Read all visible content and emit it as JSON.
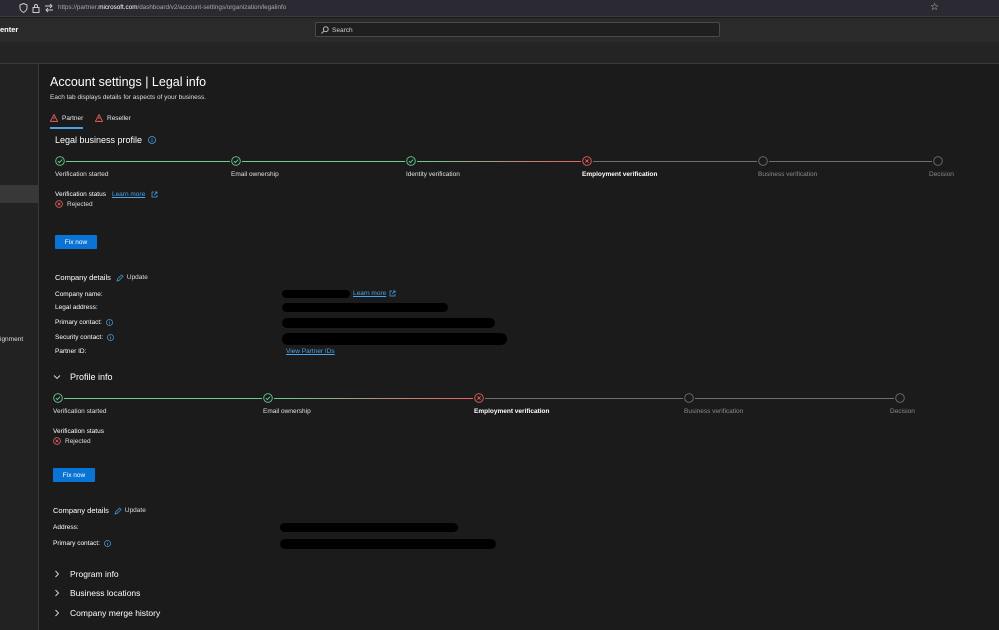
{
  "browser": {
    "url_prefix": "https://partner.",
    "url_domain": "microsoft.com",
    "url_path": "/dashboard/v2/account-settings/organization/legalinfo"
  },
  "app": {
    "brand": "enter",
    "search_placeholder": "Search"
  },
  "leftnav": {
    "partial_item": "ignment"
  },
  "page": {
    "title": "Account settings | Legal info",
    "subtitle": "Each tab displays details for aspects of your business.",
    "tabs": [
      {
        "label": "Partner",
        "selected": true
      },
      {
        "label": "Reseller",
        "selected": false
      }
    ]
  },
  "legal_profile": {
    "title": "Legal business profile",
    "steps": [
      {
        "label": "Verification started",
        "state": "done"
      },
      {
        "label": "Email ownership",
        "state": "done"
      },
      {
        "label": "Identity verification",
        "state": "done"
      },
      {
        "label": "Employment verification",
        "state": "rejected"
      },
      {
        "label": "Business verification",
        "state": "pending"
      },
      {
        "label": "Decision",
        "state": "pending"
      }
    ],
    "status_label": "Verification status",
    "learn_more": "Learn more",
    "status_value": "Rejected",
    "fix_button": "Fix now",
    "company_details": {
      "title": "Company details",
      "update": "Update",
      "rows": {
        "company_name": "Company name:",
        "legal_address": "Legal address:",
        "primary_contact": "Primary contact:",
        "security_contact": "Security contact:",
        "partner_id": "Partner ID:"
      },
      "learn_more": "Learn more",
      "view_partner_ids": "View Partner IDs"
    }
  },
  "profile_info": {
    "title": "Profile info",
    "steps": [
      {
        "label": "Verification started",
        "state": "done"
      },
      {
        "label": "Email ownership",
        "state": "done"
      },
      {
        "label": "Employment verification",
        "state": "rejected"
      },
      {
        "label": "Business verification",
        "state": "pending"
      },
      {
        "label": "Decision",
        "state": "pending"
      }
    ],
    "status_label": "Verification status",
    "status_value": "Rejected",
    "fix_button": "Fix now",
    "company_details": {
      "title": "Company details",
      "update": "Update",
      "rows": {
        "address": "Address:",
        "primary_contact": "Primary contact:"
      }
    }
  },
  "collapsed_sections": [
    "Program info",
    "Business locations",
    "Company merge history"
  ],
  "colors": {
    "done": "#6ccb8f",
    "rejected": "#e8615d",
    "pending": "#6f6f6f",
    "accent": "#0a74d6",
    "link": "#4aa3e8"
  }
}
